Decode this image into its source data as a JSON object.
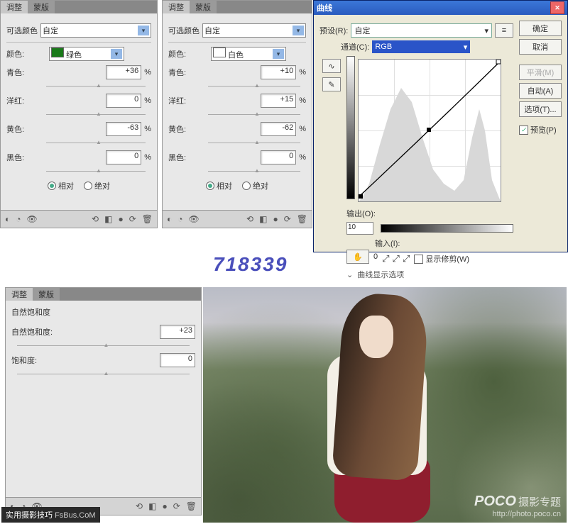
{
  "panelA": {
    "tab1": "调整",
    "tab2": "蒙版",
    "type": "可选颜色",
    "preset": "自定",
    "color_label": "颜色:",
    "color": "绿色",
    "cyan_label": "青色:",
    "cyan": "+36",
    "magenta_label": "洋红:",
    "magenta": "0",
    "yellow_label": "黄色:",
    "yellow": "-63",
    "black_label": "黑色:",
    "black": "0",
    "pct": "%",
    "rel": "相对",
    "abs": "绝对"
  },
  "panelB": {
    "tab1": "调整",
    "tab2": "蒙版",
    "type": "可选颜色",
    "preset": "自定",
    "color_label": "颜色:",
    "color": "白色",
    "cyan_label": "青色:",
    "cyan": "+10",
    "magenta_label": "洋红:",
    "magenta": "+15",
    "yellow_label": "黄色:",
    "yellow": "-62",
    "black_label": "黑色:",
    "black": "0",
    "pct": "%",
    "rel": "相对",
    "abs": "绝对"
  },
  "panelC": {
    "tab1": "调整",
    "tab2": "蒙版",
    "type": "自然饱和度",
    "vibrance_label": "自然饱和度:",
    "vibrance": "+23",
    "sat_label": "饱和度:",
    "sat": "0"
  },
  "curves": {
    "title": "曲线",
    "preset_label": "预设(R):",
    "preset": "自定",
    "channel_label": "通道(C):",
    "channel": "RGB",
    "output_label": "输出(O):",
    "output": "10",
    "input_label": "输入(I):",
    "input": "0",
    "ok": "确定",
    "cancel": "取消",
    "smooth": "平滑(M)",
    "auto": "自动(A)",
    "options": "选项(T)...",
    "preview": "预览(P)",
    "show_clip": "显示修剪(W)",
    "show_opts": "曲线显示选项"
  },
  "wm": "718339",
  "photo": {
    "logo": "POCO",
    "sub": "摄影专题",
    "url": "http://photo.poco.cn"
  },
  "badge": {
    "label": "实用摄影技巧",
    "url": "FsBus.CoM"
  }
}
